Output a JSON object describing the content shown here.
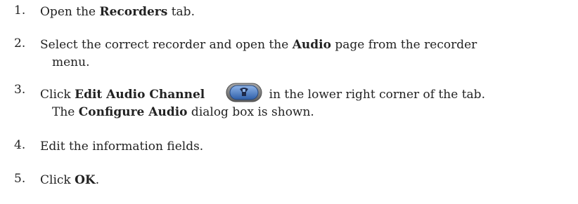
{
  "steps": [
    {
      "number": "1.",
      "before": "Open the ",
      "bold": "Recorders",
      "after": " tab."
    },
    {
      "number": "2.",
      "before": "Select the correct recorder and open the ",
      "bold": "Audio",
      "after": " page from the recorder",
      "continuation": "menu."
    },
    {
      "number": "3.",
      "before": "Click ",
      "bold": "Edit Audio Channel",
      "icon": "edit-audio-channel-icon",
      "after": " in the lower right corner of the tab.",
      "continuation_bold": "Configure Audio",
      "continuation_before": "The ",
      "continuation_after": " dialog box is shown."
    },
    {
      "number": "4.",
      "text": "Edit the information fields."
    },
    {
      "number": "5.",
      "before": "Click ",
      "bold": "OK",
      "after": "."
    }
  ],
  "colors": {
    "text": "#222222",
    "icon_outer": "#6c6c6c",
    "icon_inner": "#4a76b8",
    "icon_glyph": "#1e2a4a"
  }
}
